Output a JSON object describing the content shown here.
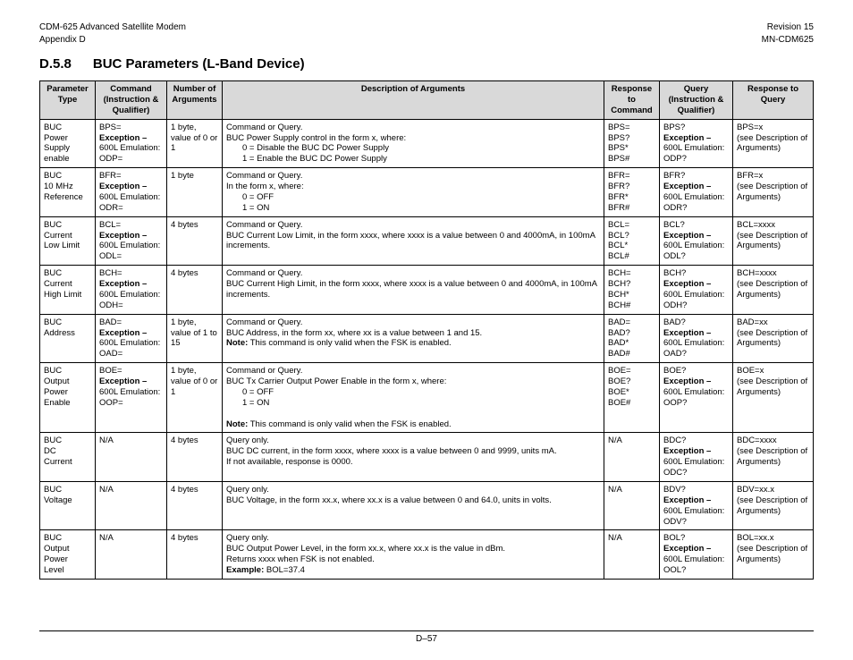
{
  "header": {
    "l1": "CDM-625 Advanced Satellite Modem",
    "l2": "Appendix D",
    "r1": "Revision 15",
    "r2": "MN-CDM625"
  },
  "title": {
    "num": "D.5.8",
    "txt": "BUC Parameters (L-Band Device)"
  },
  "cols": {
    "c1": "Parameter Type",
    "c2": "Command (Instruction & Qualifier)",
    "c3": "Number of Arguments",
    "c4": "Description of Arguments",
    "c5": "Response to Command",
    "c6": "Query (Instruction & Qualifier)",
    "c7": "Response to Query"
  },
  "rows": [
    {
      "pt": [
        "BUC",
        "Power Supply enable"
      ],
      "cmd": {
        "l1": "BPS=",
        "exc": "Exception –",
        "emu": "600L Emulation:",
        "alt": "ODP="
      },
      "nargs": "1 byte, value of 0 or 1",
      "desc": {
        "l1": "Command or Query.",
        "l2": "BUC Power Supply control in the form x, where:",
        "i1": "0 = Disable the BUC DC Power Supply",
        "i2": "1 = Enable the BUC DC Power Supply",
        "note": ""
      },
      "rcmd": [
        "BPS=",
        "BPS?",
        "BPS*",
        "BPS#"
      ],
      "qry": {
        "l1": "BPS?",
        "exc": "Exception –",
        "emu": "600L Emulation:",
        "alt": "ODP?"
      },
      "rqry": [
        "BPS=x",
        "(see Description of Arguments)"
      ]
    },
    {
      "pt": [
        "BUC",
        "10 MHz",
        "Reference"
      ],
      "cmd": {
        "l1": "BFR=",
        "exc": "Exception –",
        "emu": "600L Emulation:",
        "alt": "ODR="
      },
      "nargs": "1 byte",
      "desc": {
        "l1": "Command or Query.",
        "l2": "In the form x, where:",
        "i1": "0 = OFF",
        "i2": "1 = ON",
        "note": ""
      },
      "rcmd": [
        "BFR=",
        "BFR?",
        "BFR*",
        "BFR#"
      ],
      "qry": {
        "l1": "BFR?",
        "exc": "Exception –",
        "emu": "600L Emulation:",
        "alt": "ODR?"
      },
      "rqry": [
        "BFR=x",
        "(see Description of Arguments)"
      ]
    },
    {
      "pt": [
        "BUC",
        "Current",
        "Low Limit"
      ],
      "cmd": {
        "l1": "BCL=",
        "exc": "Exception –",
        "emu": "600L Emulation:",
        "alt": "ODL="
      },
      "nargs": "4 bytes",
      "desc": {
        "l1": "Command or Query.",
        "l2": "BUC Current Low Limit, in the form xxxx, where xxxx is a value between 0 and 4000mA, in 100mA increments.",
        "i1": "",
        "i2": "",
        "note": ""
      },
      "rcmd": [
        "BCL=",
        "BCL?",
        "BCL*",
        "BCL#"
      ],
      "qry": {
        "l1": "BCL?",
        "exc": "Exception –",
        "emu": "600L Emulation:",
        "alt": "ODL?"
      },
      "rqry": [
        "BCL=xxxx",
        "(see Description of Arguments)"
      ]
    },
    {
      "pt": [
        "BUC",
        "Current",
        "High Limit"
      ],
      "cmd": {
        "l1": "BCH=",
        "exc": "Exception –",
        "emu": "600L Emulation:",
        "alt": "ODH="
      },
      "nargs": "4 bytes",
      "desc": {
        "l1": "Command or Query.",
        "l2": "BUC Current High Limit, in the form xxxx, where xxxx is a value between 0 and 4000mA, in 100mA increments.",
        "i1": "",
        "i2": "",
        "note": ""
      },
      "rcmd": [
        "BCH=",
        "BCH?",
        "BCH*",
        "BCH#"
      ],
      "qry": {
        "l1": "BCH?",
        "exc": "Exception –",
        "emu": "600L Emulation:",
        "alt": "ODH?"
      },
      "rqry": [
        "BCH=xxxx",
        "(see Description of Arguments)"
      ]
    },
    {
      "pt": [
        "BUC",
        "Address"
      ],
      "cmd": {
        "l1": "BAD=",
        "exc": "Exception –",
        "emu": "600L Emulation:",
        "alt": "OAD="
      },
      "nargs": "1 byte, value of  1 to 15",
      "desc": {
        "l1": "Command or Query.",
        "l2": "BUC Address, in the form xx, where xx is a value between 1 and 15.",
        "i1": "",
        "i2": "",
        "note": "This command is only valid when the FSK is enabled."
      },
      "rcmd": [
        "BAD=",
        "BAD?",
        "BAD*",
        "BAD#"
      ],
      "qry": {
        "l1": "BAD?",
        "exc": "Exception –",
        "emu": "600L Emulation:",
        "alt": "OAD?"
      },
      "rqry": [
        "BAD=xx",
        "(see Description of Arguments)"
      ]
    },
    {
      "pt": [
        "BUC",
        "Output Power",
        "Enable"
      ],
      "cmd": {
        "l1": "BOE=",
        "exc": "Exception –",
        "emu": "600L Emulation:",
        "alt": "OOP="
      },
      "nargs": "1 byte, value of  0 or 1",
      "desc": {
        "l1": "Command or Query.",
        "l2": "BUC Tx Carrier Output Power Enable in the form x, where:",
        "i1": "0 = OFF",
        "i2": "1 = ON",
        "note": "This command is only valid when the FSK is enabled."
      },
      "rcmd": [
        "BOE=",
        "BOE?",
        "BOE*",
        "BOE#"
      ],
      "qry": {
        "l1": "BOE?",
        "exc": "Exception –",
        "emu": "600L Emulation:",
        "alt": "OOP?"
      },
      "rqry": [
        "BOE=x",
        "(see Description of Arguments)"
      ]
    },
    {
      "pt": [
        "BUC",
        "DC",
        "Current"
      ],
      "cmd": {
        "l1": "N/A",
        "exc": "",
        "emu": "",
        "alt": ""
      },
      "nargs": "4 bytes",
      "desc": {
        "l1": "Query only.",
        "l2": "BUC DC current, in the form xxxx, where xxxx is a value between 0 and 9999, units mA.",
        "i1": "",
        "i2": "",
        "note": "",
        "extra": "If not available, response is 0000."
      },
      "rcmd": [
        "N/A"
      ],
      "qry": {
        "l1": "BDC?",
        "exc": "Exception –",
        "emu": "600L Emulation:",
        "alt": "ODC?"
      },
      "rqry": [
        "BDC=xxxx",
        "(see Description of Arguments)"
      ]
    },
    {
      "pt": [
        "BUC",
        "Voltage"
      ],
      "cmd": {
        "l1": "N/A",
        "exc": "",
        "emu": "",
        "alt": ""
      },
      "nargs": "4 bytes",
      "desc": {
        "l1": "Query only.",
        "l2": "BUC Voltage, in the form xx.x, where xx.x is a value between 0 and 64.0, units in volts.",
        "i1": "",
        "i2": "",
        "note": ""
      },
      "rcmd": [
        "N/A"
      ],
      "qry": {
        "l1": "BDV?",
        "exc": "Exception –",
        "emu": "600L Emulation:",
        "alt": "ODV?"
      },
      "rqry": [
        "BDV=xx.x",
        "(see Description of Arguments)"
      ]
    },
    {
      "pt": [
        "BUC",
        "Output Power",
        "Level"
      ],
      "cmd": {
        "l1": "N/A",
        "exc": "",
        "emu": "",
        "alt": ""
      },
      "nargs": "4 bytes",
      "desc": {
        "l1": "Query only.",
        "l2": "BUC Output Power Level, in the form xx.x, where xx.x is the value in dBm.",
        "i1": "",
        "i2": "",
        "note": "",
        "extra": "Returns xxxx when FSK is not enabled.",
        "example": "BOL=37.4"
      },
      "rcmd": [
        "N/A"
      ],
      "qry": {
        "l1": "BOL?",
        "exc": "Exception –",
        "emu": "600L Emulation:",
        "alt": "OOL?"
      },
      "rqry": [
        "BOL=xx.x",
        "(see Description of Arguments)"
      ]
    }
  ],
  "labels": {
    "note": "Note:",
    "example": "Example:"
  },
  "footer": "D–57"
}
